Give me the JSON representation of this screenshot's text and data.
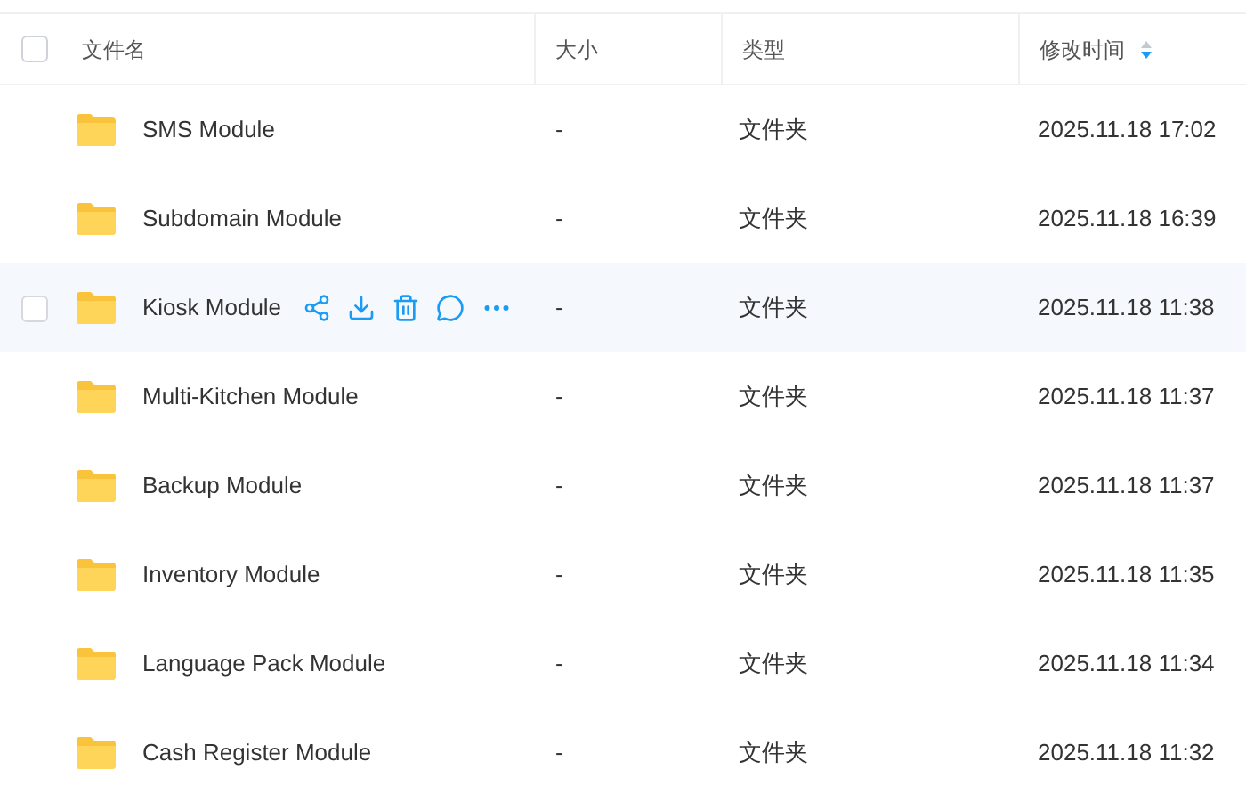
{
  "columns": [
    {
      "label": "文件名"
    },
    {
      "label": "大小"
    },
    {
      "label": "类型"
    },
    {
      "label": "修改时间",
      "sorted_descending": true
    }
  ],
  "select_all_checked": false,
  "rows": [
    {
      "name": "SMS Module",
      "size": "-",
      "type": "文件夹",
      "modified": "2025.11.18 17:02",
      "hovered": false
    },
    {
      "name": "Subdomain Module",
      "size": "-",
      "type": "文件夹",
      "modified": "2025.11.18 16:39",
      "hovered": false
    },
    {
      "name": "Kiosk Module",
      "size": "-",
      "type": "文件夹",
      "modified": "2025.11.18 11:38",
      "hovered": true,
      "checked": false
    },
    {
      "name": "Multi-Kitchen Module",
      "size": "-",
      "type": "文件夹",
      "modified": "2025.11.18 11:37",
      "hovered": false
    },
    {
      "name": "Backup Module",
      "size": "-",
      "type": "文件夹",
      "modified": "2025.11.18 11:37",
      "hovered": false
    },
    {
      "name": "Inventory Module",
      "size": "-",
      "type": "文件夹",
      "modified": "2025.11.18 11:35",
      "hovered": false
    },
    {
      "name": "Language Pack Module",
      "size": "-",
      "type": "文件夹",
      "modified": "2025.11.18 11:34",
      "hovered": false
    },
    {
      "name": "Cash Register Module",
      "size": "-",
      "type": "文件夹",
      "modified": "2025.11.18 11:32",
      "hovered": false
    }
  ]
}
